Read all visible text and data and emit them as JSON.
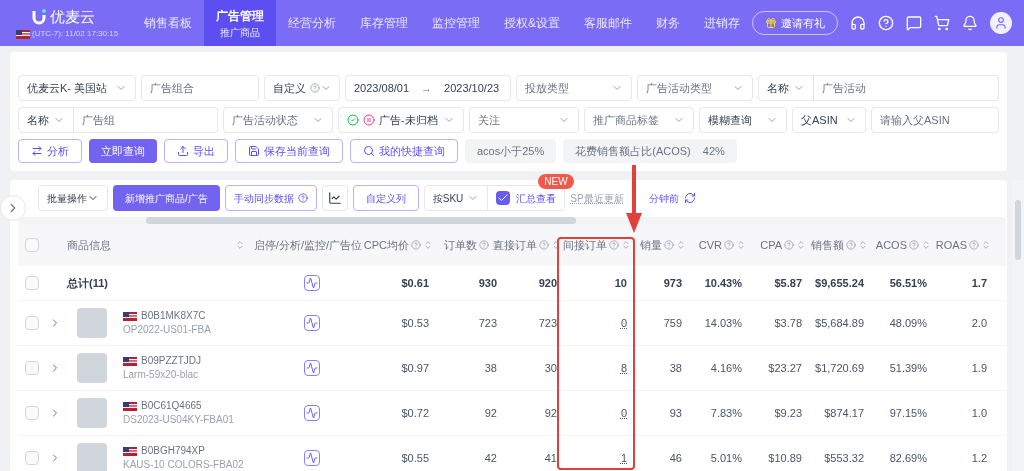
{
  "header": {
    "logo": "优麦云",
    "clock": "(UTC-7): 11/02 17:30:15",
    "nav": [
      {
        "label": "销售看板",
        "selected": false
      },
      {
        "label": "广告管理",
        "sub": "推广商品",
        "selected": true
      },
      {
        "label": "经营分析",
        "selected": false
      },
      {
        "label": "库存管理",
        "selected": false
      },
      {
        "label": "监控管理",
        "selected": false
      },
      {
        "label": "授权&设置",
        "selected": false
      },
      {
        "label": "客服邮件",
        "selected": false
      },
      {
        "label": "财务",
        "selected": false
      },
      {
        "label": "进销存",
        "selected": false
      }
    ],
    "invite": "邀请有礼"
  },
  "filters": [
    [
      {
        "kind": "select",
        "value": "优麦云K- 美国站"
      },
      {
        "kind": "input",
        "placeholder": "广告组合"
      },
      {
        "kind": "select",
        "value": "自定义",
        "help": true
      },
      {
        "kind": "daterange",
        "start": "2023/08/01",
        "separator": "→",
        "end": "2023/10/23"
      },
      {
        "kind": "select",
        "placeholder": "投放类型"
      },
      {
        "kind": "select",
        "placeholder": "广告活动类型"
      },
      {
        "kind": "combo",
        "value": "名称",
        "placeholder": "广告活动"
      }
    ],
    [
      {
        "kind": "combo",
        "value": "名称",
        "placeholder": "广告组"
      },
      {
        "kind": "select",
        "placeholder": "广告活动状态"
      },
      {
        "kind": "status",
        "value": "广告-未归档"
      },
      {
        "kind": "select",
        "placeholder": "关注"
      },
      {
        "kind": "select",
        "placeholder": "推广商品标签"
      },
      {
        "kind": "select",
        "value": "模糊查询"
      },
      {
        "kind": "select",
        "value": "父ASIN"
      },
      {
        "kind": "input",
        "placeholder": "请输入父ASIN"
      }
    ]
  ],
  "actions": [
    {
      "kind": "analyze",
      "label": "分析"
    },
    {
      "kind": "primary",
      "label": "立即查询"
    },
    {
      "kind": "export",
      "label": "导出"
    },
    {
      "kind": "save",
      "label": "保存当前查询"
    },
    {
      "kind": "search",
      "label": "我的快捷查询"
    }
  ],
  "chips": [
    {
      "label": "acos小于25%"
    },
    {
      "label": "花费销售额占比(ACOS)",
      "value": "42%"
    }
  ],
  "toolbar": {
    "batch": "批量操作",
    "add": "新增推广商品/广告",
    "sync": "手动同步数据",
    "columns": "自定义列",
    "group": "按SKU",
    "summary": {
      "label": "汇总查看",
      "checked": true,
      "badge": "NEW"
    },
    "updated": "SP最近更新",
    "updated_tail": "分钟前"
  },
  "table": {
    "columns": [
      "商品信息",
      "启停/分析/监控/广告位",
      "CPC均价",
      "订单数",
      "直接订单",
      "间接订单",
      "销量",
      "CVR",
      "CPA",
      "销售额",
      "ACOS",
      "ROAS"
    ],
    "all_checked": false,
    "total": {
      "checked": false,
      "label": "总计(11)",
      "values": [
        "$0.61",
        "930",
        "920",
        "10",
        "973",
        "10.43%",
        "$5.87",
        "$9,655.24",
        "56.51%",
        "1.7"
      ]
    },
    "rows": [
      {
        "checked": false,
        "asin": "B0B1MK8X7C",
        "sku": "OP2022-US01-FBA",
        "values": [
          "$0.53",
          "723",
          "723",
          "0",
          "759",
          "14.03%",
          "$3.78",
          "$5,684.89",
          "48.09%",
          "2.0"
        ]
      },
      {
        "checked": false,
        "asin": "B09PZZTJDJ",
        "sku": "Larm-59x20-blac",
        "values": [
          "$0.97",
          "38",
          "30",
          "8",
          "38",
          "4.16%",
          "$23.27",
          "$1,720.69",
          "51.39%",
          "1.9"
        ]
      },
      {
        "checked": false,
        "asin": "B0C61Q4665",
        "sku": "DS2023-US04KY-FBA01",
        "values": [
          "$0.72",
          "92",
          "92",
          "0",
          "93",
          "7.83%",
          "$9.23",
          "$874.17",
          "97.15%",
          "1.0"
        ]
      },
      {
        "checked": false,
        "asin": "B0BGH794XP",
        "sku": "KAUS-10 COLORS-FBA02",
        "values": [
          "$0.55",
          "42",
          "41",
          "1",
          "46",
          "5.01%",
          "$10.89",
          "$553.32",
          "82.69%",
          "1.2"
        ]
      }
    ]
  }
}
